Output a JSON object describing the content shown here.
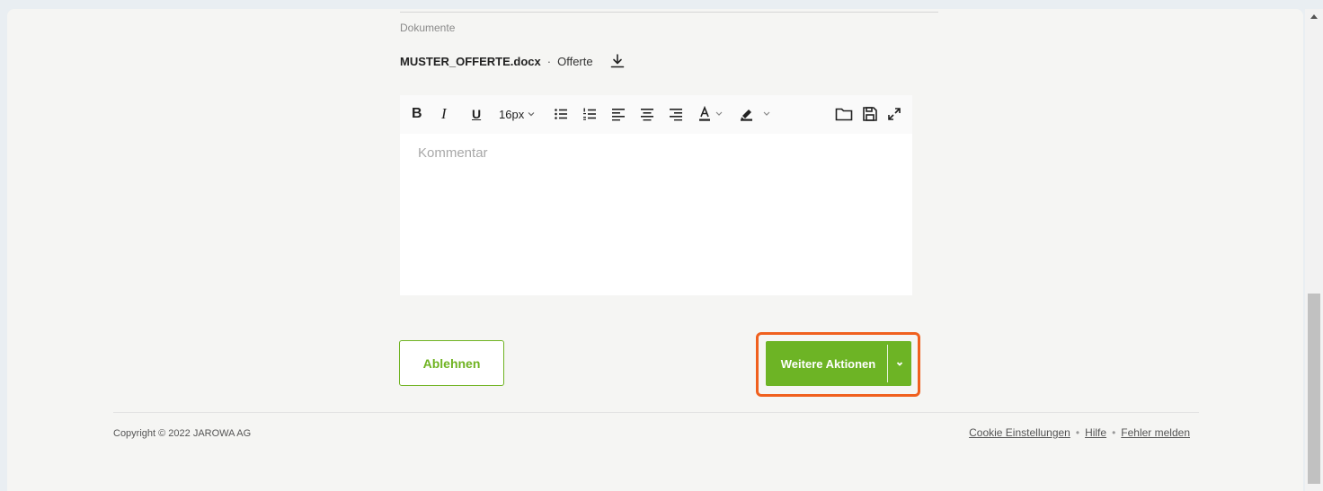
{
  "documents": {
    "label": "Dokumente",
    "file_name": "MUSTER_OFFERTE.docx",
    "separator": "·",
    "file_type": "Offerte"
  },
  "editor": {
    "font_size": "16px",
    "placeholder": "Kommentar",
    "toolbar_icons": [
      "bold-icon",
      "italic-icon",
      "underline-icon",
      "font-size-dropdown",
      "bullet-list-icon",
      "numbered-list-icon",
      "align-left-icon",
      "align-center-icon",
      "align-right-icon",
      "text-color-icon",
      "highlight-color-icon",
      "folder-icon",
      "save-icon",
      "fullscreen-icon"
    ]
  },
  "actions": {
    "reject_label": "Ablehnen",
    "more_actions_label": "Weitere Aktionen"
  },
  "footer": {
    "copyright": "Copyright © 2022 JAROWA AG",
    "links": [
      "Cookie Einstellungen",
      "Hilfe",
      "Fehler melden"
    ],
    "separator": "•"
  },
  "colors": {
    "accent_green": "#6db425",
    "highlight_orange": "#f0601e"
  }
}
